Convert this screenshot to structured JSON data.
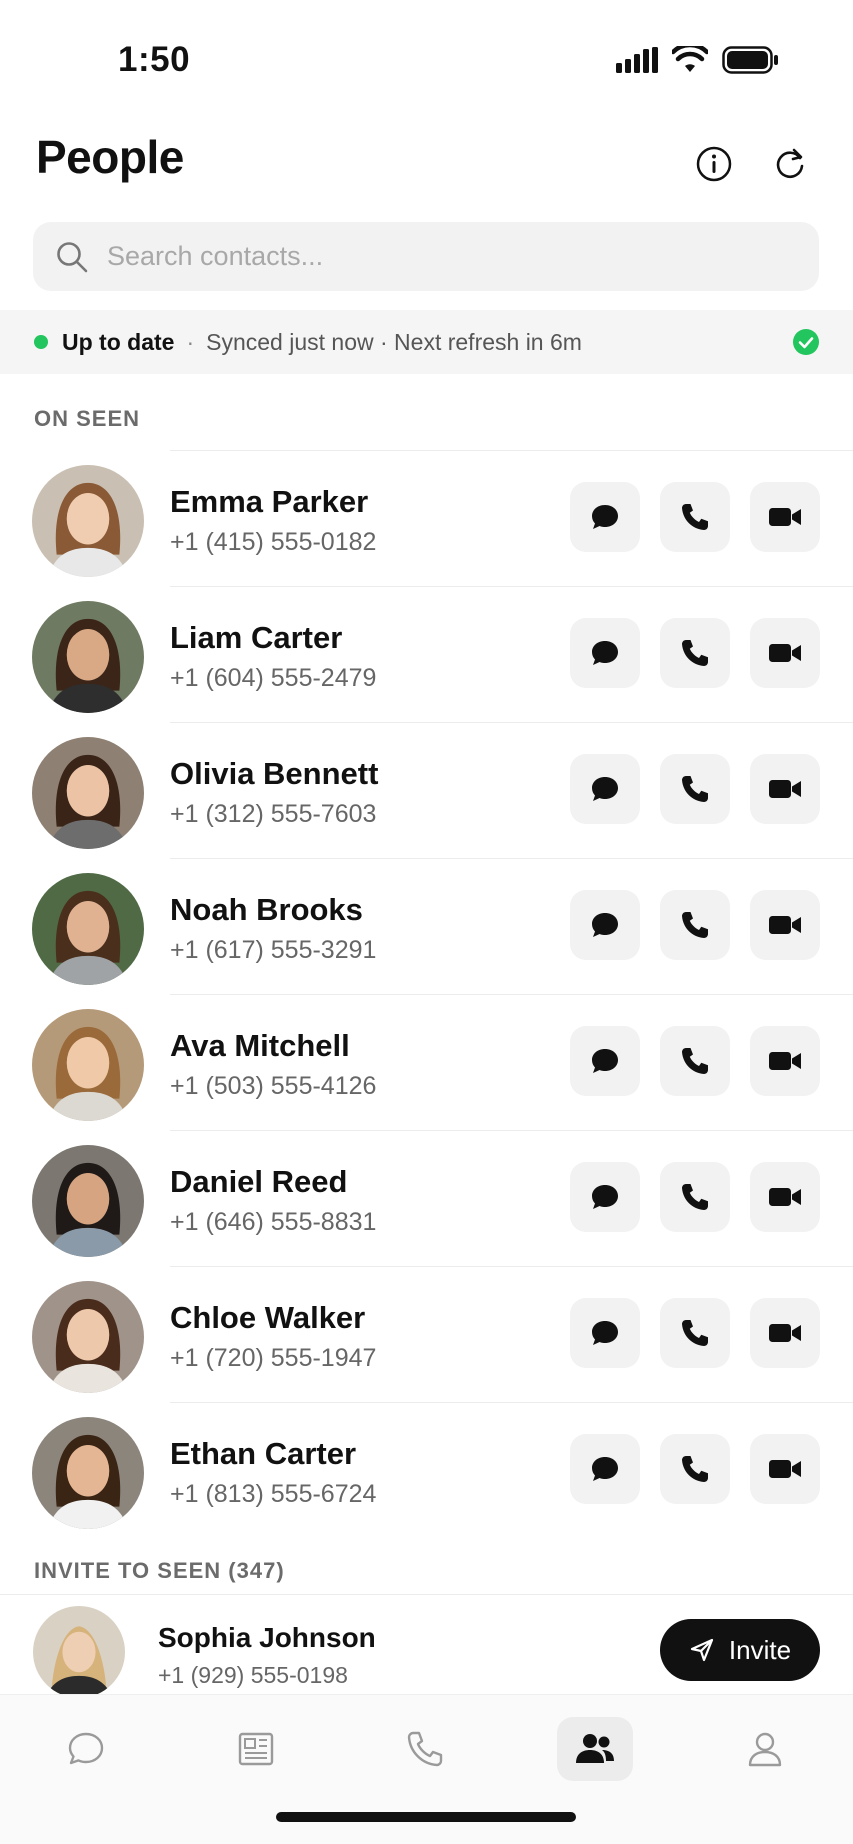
{
  "status_bar": {
    "time": "1:50"
  },
  "header": {
    "title": "People"
  },
  "search": {
    "placeholder": "Search contacts..."
  },
  "sync": {
    "status": "Up to date",
    "separator": "·",
    "detail": "Synced just now · Next refresh in 6m"
  },
  "sections": {
    "on_seen": "ON SEEN",
    "invite": "INVITE TO SEEN (347)"
  },
  "contacts": [
    {
      "name": "Emma Parker",
      "phone": "+1 (415) 555-0182"
    },
    {
      "name": "Liam Carter",
      "phone": "+1 (604) 555-2479"
    },
    {
      "name": "Olivia Bennett",
      "phone": "+1 (312) 555-7603"
    },
    {
      "name": "Noah Brooks",
      "phone": "+1 (617) 555-3291"
    },
    {
      "name": "Ava Mitchell",
      "phone": "+1 (503) 555-4126"
    },
    {
      "name": "Daniel Reed",
      "phone": "+1 (646) 555-8831"
    },
    {
      "name": "Chloe Walker",
      "phone": "+1 (720) 555-1947"
    },
    {
      "name": "Ethan Carter",
      "phone": "+1 (813) 555-6724"
    }
  ],
  "invite_contact": {
    "name": "Sophia Johnson",
    "phone": "+1 (929) 555-0198",
    "button_label": "Invite"
  },
  "tabs": [
    {
      "icon": "chat-icon",
      "active": false
    },
    {
      "icon": "news-icon",
      "active": false
    },
    {
      "icon": "phone-icon",
      "active": false
    },
    {
      "icon": "people-icon",
      "active": true
    },
    {
      "icon": "profile-icon",
      "active": false
    }
  ],
  "colors": {
    "sync_ok": "#22c55e",
    "invite_button": "#111111",
    "action_button_bg": "#f2f2f2"
  }
}
